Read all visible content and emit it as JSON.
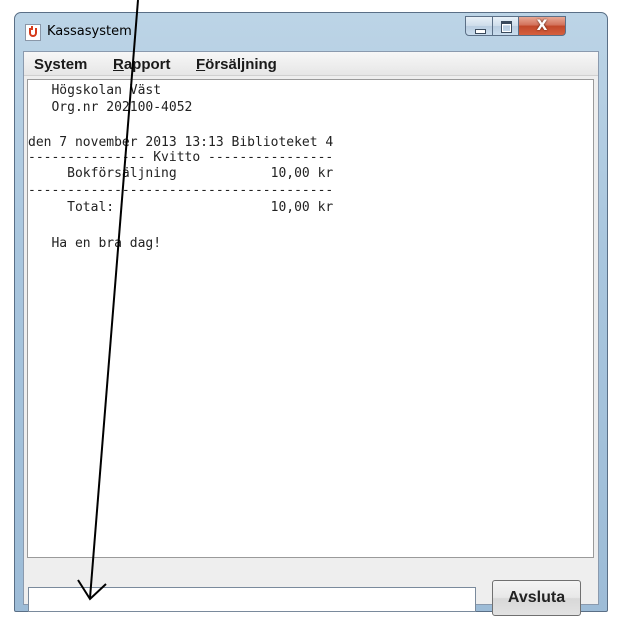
{
  "window": {
    "title": "Kassasystem",
    "icon": "java-cup-icon",
    "controls": {
      "minimize_icon": "minimize-icon",
      "maximize_icon": "maximize-icon",
      "close_label": "X"
    }
  },
  "menubar": {
    "items": [
      {
        "mnemonic": "",
        "label_before": "S",
        "label_mn": "y",
        "label_after": "stem"
      },
      {
        "label_before": "",
        "label_mn": "R",
        "label_after": "apport"
      },
      {
        "label_before": "",
        "label_mn": "F",
        "label_after": "örsäljning"
      }
    ]
  },
  "receipt": {
    "lines": [
      "   Högskolan Väst",
      "   Org.nr 202100-4052",
      "",
      "den 7 november 2013 13:13 Biblioteket 4",
      "--------------- Kvitto ----------------",
      "     Bokförsäljning            10,00 kr",
      "---------------------------------------",
      "     Total:                    10,00 kr",
      "",
      "   Ha en bra dag!"
    ]
  },
  "input": {
    "value": ""
  },
  "buttons": {
    "exit_label": "Avsluta"
  },
  "overlay": {
    "arrow": "annotation-arrow"
  }
}
